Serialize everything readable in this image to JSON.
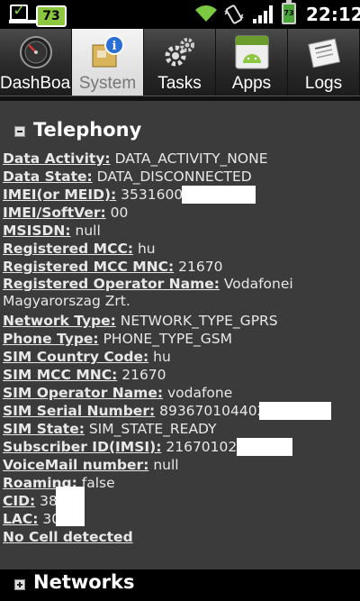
{
  "status_bar": {
    "battery_badge": "73",
    "battery_level": "73",
    "time": "22:12",
    "icons": [
      "checkbox-icon",
      "wifi-icon",
      "vibrate-icon",
      "signal-icon",
      "battery-icon"
    ]
  },
  "tabs": [
    {
      "label": "DashBoard",
      "icon": "dashboard-icon",
      "selected": false
    },
    {
      "label": "System",
      "icon": "system-info-icon",
      "selected": true
    },
    {
      "label": "Tasks",
      "icon": "gears-icon",
      "selected": false
    },
    {
      "label": "Apps",
      "icon": "android-apps-icon",
      "selected": false
    },
    {
      "label": "Logs",
      "icon": "newspaper-icon",
      "selected": false
    }
  ],
  "telephony": {
    "title": "Telephony",
    "rows": [
      {
        "key": "Data Activity:",
        "value": " DATA_ACTIVITY_NONE"
      },
      {
        "key": "Data State:",
        "value": " DATA_DISCONNECTED"
      },
      {
        "key": "IMEI(or MEID):",
        "value": " 3531600"
      },
      {
        "key": "IMEI/SoftVer:",
        "value": " 00"
      },
      {
        "key": "MSISDN:",
        "value": " null"
      },
      {
        "key": "Registered MCC:",
        "value": " hu"
      },
      {
        "key": "Registered MCC MNC:",
        "value": " 21670"
      },
      {
        "key": "Registered Operator Name:",
        "value": " Vodafonei Magyarorszag Zrt."
      },
      {
        "key": "Network Type:",
        "value": " NETWORK_TYPE_GPRS"
      },
      {
        "key": "Phone Type:",
        "value": " PHONE_TYPE_GSM"
      },
      {
        "key": "SIM Country Code:",
        "value": " hu"
      },
      {
        "key": "SIM MCC MNC:",
        "value": " 21670"
      },
      {
        "key": "SIM Operator Name:",
        "value": " vodafone"
      },
      {
        "key": "SIM Serial Number:",
        "value": " 893670104402"
      },
      {
        "key": "SIM State:",
        "value": " SIM_STATE_READY"
      },
      {
        "key": "Subscriber ID(IMSI):",
        "value": " 216701020"
      },
      {
        "key": "VoiceMail number:",
        "value": " null"
      },
      {
        "key": "Roaming:",
        "value": " false"
      },
      {
        "key": "CID:",
        "value": " 38"
      },
      {
        "key": "LAC:",
        "value": " 30"
      }
    ],
    "no_cell": "No Cell detected"
  },
  "networks": {
    "title": "Networks"
  },
  "colors": {
    "content_bg": "#3b3b3b",
    "battery_badge": "#8dc63f"
  }
}
